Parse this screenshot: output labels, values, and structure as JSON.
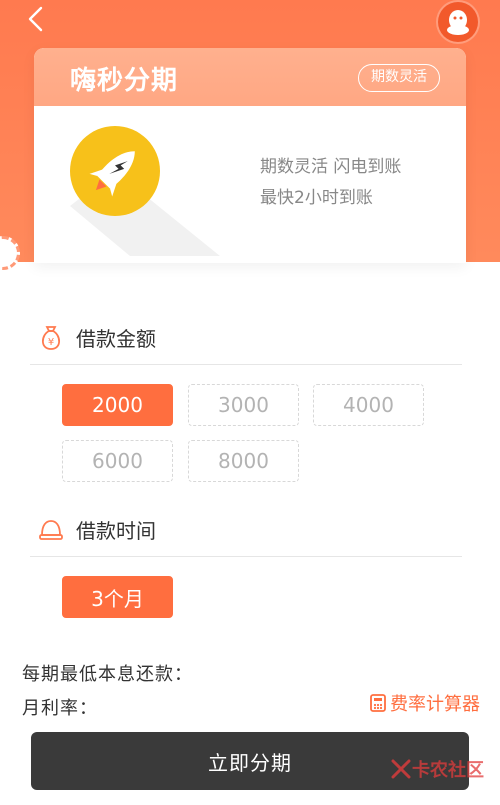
{
  "header": {
    "back_icon": "chevron-left-icon",
    "avatar_icon": "penguin-icon"
  },
  "card": {
    "title": "嗨秒分期",
    "tag": "期数灵活",
    "desc_line1": "期数灵活 闪电到账",
    "desc_line2": "最快2小时到账",
    "icon": "rocket-icon",
    "icon_bg": "#f7c11a"
  },
  "loan_amount": {
    "label": "借款金额",
    "icon": "money-bag-icon",
    "options": [
      "2000",
      "3000",
      "4000",
      "6000",
      "8000"
    ],
    "selected": "2000"
  },
  "loan_term": {
    "label": "借款时间",
    "icon": "bell-icon",
    "options": [
      "3个月"
    ],
    "selected": "3个月"
  },
  "info": {
    "min_repayment_label": "每期最低本息还款：",
    "monthly_rate_label": "月利率："
  },
  "calculator": {
    "label": "费率计算器",
    "icon": "calculator-icon"
  },
  "submit": {
    "label": "立即分期"
  },
  "watermark": {
    "text": "卡农社区"
  },
  "colors": {
    "accent": "#ff6e3f",
    "header_bg": "#ff7a4f",
    "button_bg": "#3a3a3a"
  }
}
